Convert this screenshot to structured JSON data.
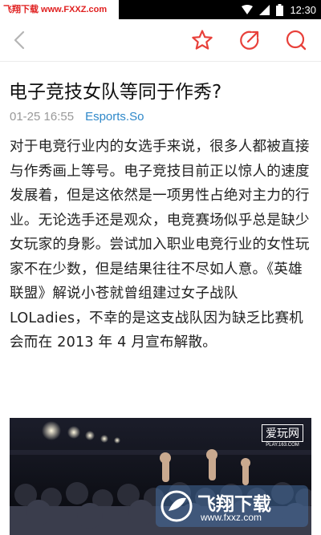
{
  "status_bar": {
    "watermark": "飞翔下载 www.FXXZ.com",
    "time": "12:30"
  },
  "toolbar": {
    "icons": [
      "back-arrow-icon",
      "star-icon",
      "edit-share-icon",
      "comment-icon"
    ],
    "accent_color": "#e8403a"
  },
  "article": {
    "title": "电子竞技女队等同于作秀?",
    "date": "01-25 16:55",
    "source": "Esports.So",
    "paragraph": "对于电竞行业内的女选手来说，很多人都被直接与作秀画上等号。电子竞技目前正以惊人的速度发展着，但是这依然是一项男性占绝对主力的行业。无论选手还是观众，电竞赛场似乎总是缺少女玩家的身影。尝试加入职业电竞行业的女性玩家不在少数，但是结果往往不尽如人意。《英雄联盟》解说小苍就曾组建过女子战队 LOLadies，不幸的是这支战队因为缺乏比赛机会而在 2013 年 4 月宣布解散。"
  },
  "image": {
    "photo_watermark_main": "爱玩网",
    "photo_watermark_sub": "PLAY.163.COM",
    "badge_title": "飞翔下载",
    "badge_url": "www.fxxz.com"
  }
}
